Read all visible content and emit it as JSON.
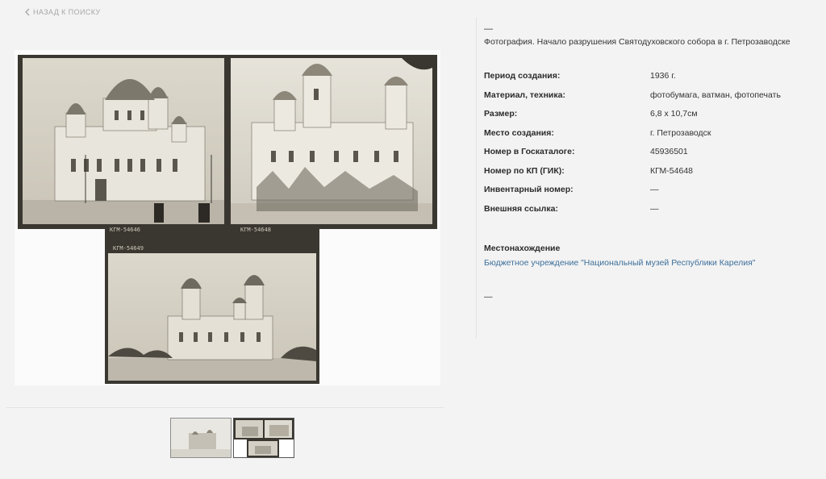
{
  "nav": {
    "back_label": "НАЗАД К ПОИСКУ",
    "back_icon": "chevron-left-icon"
  },
  "info": {
    "dash_top": "—",
    "title": "Фотография. Начало разрушения Святодуховского собора в г. Петрозаводске",
    "properties": [
      {
        "label": "Период создания:",
        "value": "1936 г."
      },
      {
        "label": "Материал, техника:",
        "value": "фотобумага, ватман, фотопечать"
      },
      {
        "label": "Размер:",
        "value": "6,8 х 10,7см"
      },
      {
        "label": "Место создания:",
        "value": "г. Петрозаводск"
      },
      {
        "label": "Номер в Госкаталоге:",
        "value": "45936501"
      },
      {
        "label": "Номер по КП (ГИК):",
        "value": "КГМ-54648"
      },
      {
        "label": "Инвентарный номер:",
        "value": "—"
      },
      {
        "label": "Внешняя ссылка:",
        "value": "—"
      }
    ],
    "location_heading": "Местонахождение",
    "location_link": "Бюджетное учреждение \"Национальный музей Республики Карелия\"",
    "dash_bottom": "—"
  },
  "photo": {
    "inscriptions": [
      "КГМ-54646",
      "КГМ-54648",
      "КГМ-54649"
    ]
  },
  "thumbnails": [
    {
      "name": "thumbnail-1",
      "active": false
    },
    {
      "name": "thumbnail-2",
      "active": true
    }
  ],
  "colors": {
    "link": "#3d6f9b",
    "label": "#2b2b2b",
    "muted": "#a7a7a7",
    "background": "#f3f3f3"
  }
}
